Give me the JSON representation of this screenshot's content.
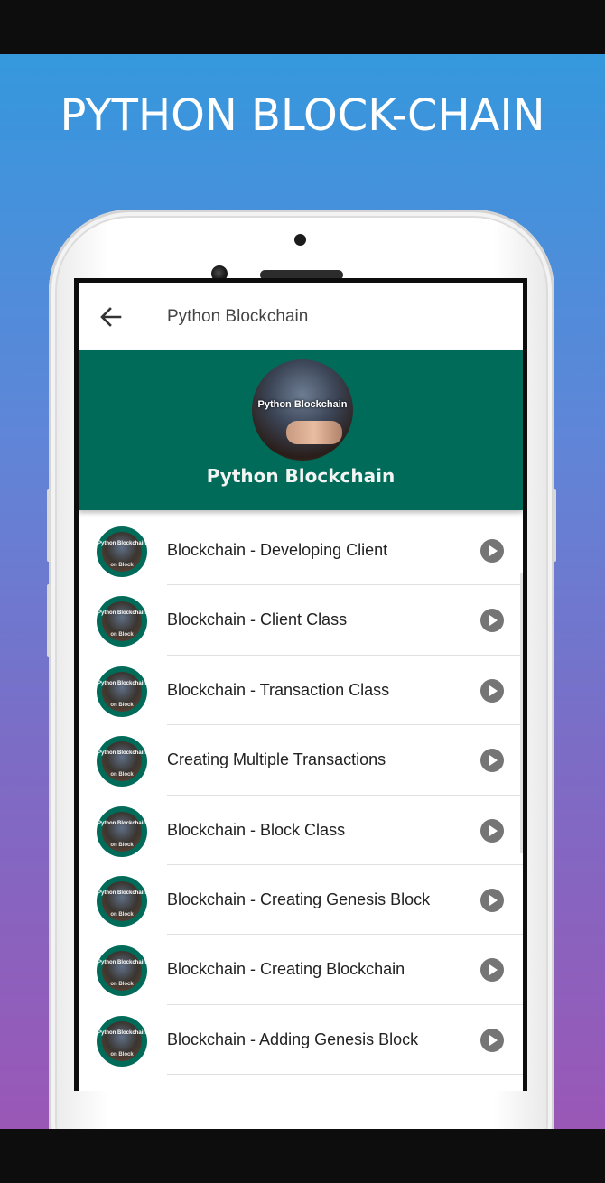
{
  "poster": {
    "headline": "PYTHON BLOCK-CHAIN",
    "gradient_top": "#3598dd",
    "gradient_bottom": "#9a57b6"
  },
  "app": {
    "appbar": {
      "back_icon": "arrow-left-icon",
      "title": "Python Blockchain"
    },
    "header": {
      "avatar_text": "Python Blockchain",
      "title": "Python Blockchain",
      "band_color": "#006b58"
    },
    "thumb_text_top": "Python Blockchain",
    "thumb_text_bottom": "on Block",
    "items": [
      {
        "label": "Blockchain - Developing Client",
        "action_icon": "play-circle-icon"
      },
      {
        "label": "Blockchain - Client Class",
        "action_icon": "play-circle-icon"
      },
      {
        "label": "Blockchain - Transaction Class",
        "action_icon": "play-circle-icon"
      },
      {
        "label": "Creating Multiple Transactions",
        "action_icon": "play-circle-icon"
      },
      {
        "label": "Blockchain - Block Class",
        "action_icon": "play-circle-icon"
      },
      {
        "label": "Blockchain - Creating Genesis Block",
        "action_icon": "play-circle-icon"
      },
      {
        "label": "Blockchain - Creating Blockchain",
        "action_icon": "play-circle-icon"
      },
      {
        "label": "Blockchain - Adding Genesis Block",
        "action_icon": "play-circle-icon"
      }
    ]
  }
}
